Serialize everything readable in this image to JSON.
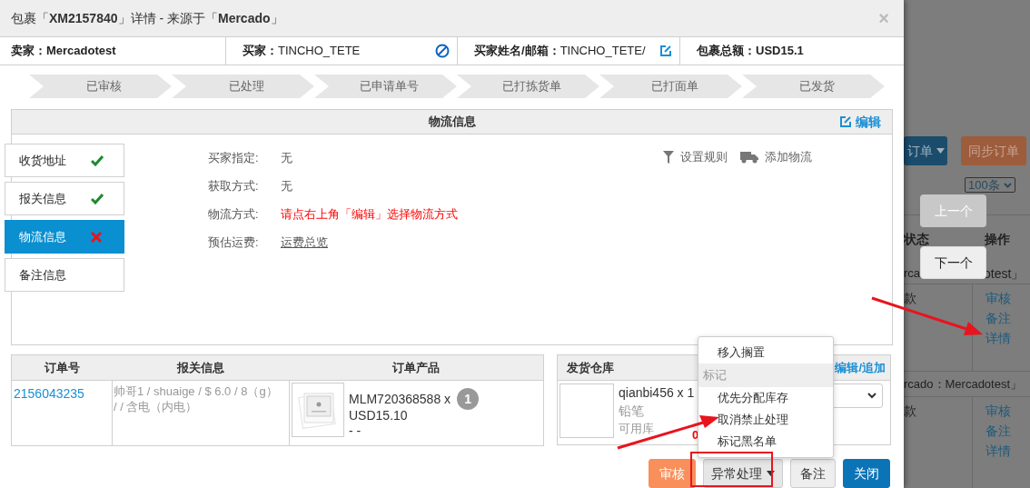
{
  "dialog": {
    "title": "包裹「**XM2157840**」详情 - 来源于「**Mercado**」",
    "close": "×"
  },
  "info_bar": [
    {
      "label": "卖家：",
      "value": "Mercadotest",
      "kind": "plain"
    },
    {
      "label": "买家：",
      "value": "TINCHO_TETE",
      "kind": "block"
    },
    {
      "label": "买家姓名/邮箱：",
      "value": "TINCHO_TETE/",
      "kind": "edit"
    },
    {
      "label": "包裹总额：",
      "value": "USD15.1",
      "kind": "plain"
    }
  ],
  "steps": [
    "已审核",
    "已处理",
    "已申请单号",
    "已打拣货单",
    "已打面单",
    "已发货"
  ],
  "logistics": {
    "title": "物流信息",
    "edit": "编辑",
    "tabs": [
      {
        "label": "收货地址",
        "kind": "done",
        "selected": false
      },
      {
        "label": "报关信息",
        "kind": "done",
        "selected": false
      },
      {
        "label": "物流信息",
        "kind": "error",
        "selected": true
      },
      {
        "label": "备注信息",
        "kind": "plain",
        "selected": false
      }
    ],
    "fields": [
      {
        "label": "买家指定:",
        "value": "无",
        "kind": "plain"
      },
      {
        "label": "获取方式:",
        "value": "无",
        "kind": "plain"
      },
      {
        "label": "物流方式:",
        "value": "请点右上角「编辑」选择物流方式",
        "kind": "warning"
      },
      {
        "label": "预估运费:",
        "value": "运费总览",
        "kind": "link"
      }
    ],
    "actions": [
      {
        "label": "设置规则",
        "kind": "filter"
      },
      {
        "label": "添加物流",
        "kind": "truck"
      }
    ]
  },
  "orders_table": {
    "columns": [
      "订单号",
      "报关信息",
      "订单产品"
    ],
    "rows": [
      {
        "order_no": "2156043235",
        "customs": "帅哥1 /  shuaige /  $ 6.0 /  8（g） /  /  含电（内电）",
        "product": {
          "sku": "MLM720368588 x",
          "qty": "1",
          "price": "USD15.10",
          "note": "- -"
        }
      }
    ]
  },
  "warehouse": {
    "title": "发货仓库",
    "edit": "编辑/追加",
    "item": {
      "name": "qianbi456 x 1",
      "desc": "铅笔",
      "stock_label": "可用库",
      "stock": "0"
    }
  },
  "menu": [
    {
      "label": "移入搁置",
      "kind": "item"
    },
    {
      "label": "标记",
      "kind": "header"
    },
    {
      "label": "优先分配库存",
      "kind": "item"
    },
    {
      "label": "取消禁止处理",
      "kind": "item"
    },
    {
      "label": "标记黑名单",
      "kind": "item"
    }
  ],
  "buttons": [
    {
      "label": "审核",
      "kind": "warning"
    },
    {
      "label": "异常处理",
      "kind": "dropdown"
    },
    {
      "label": "备注",
      "kind": "default"
    },
    {
      "label": "关闭",
      "kind": "primary"
    }
  ],
  "background_page": {
    "buttons": [
      {
        "label": "订单",
        "kind": "primary"
      },
      {
        "label": "同步订单",
        "kind": "warning"
      }
    ],
    "page_size": "100条",
    "columns": [
      "状态",
      "操作"
    ],
    "rows": [
      {
        "group": "rca",
        "group_end": "otest」",
        "status": "款",
        "actions": [
          "审核",
          "备注",
          "详情"
        ]
      },
      {
        "group": "rcado：Mercadotest」",
        "status": "款",
        "actions": [
          "审核",
          "备注",
          "详情"
        ]
      }
    ]
  },
  "nav_buttons": [
    {
      "label": "上一个",
      "disabled": true
    },
    {
      "label": "下一个",
      "disabled": false
    }
  ]
}
